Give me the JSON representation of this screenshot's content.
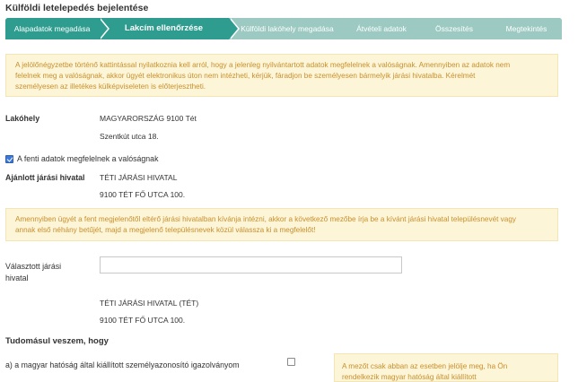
{
  "page": {
    "title": "Külföldi letelepedés bejelentése"
  },
  "steps": [
    {
      "label": "Alapadatok megadása",
      "state": "done"
    },
    {
      "label": "Lakcím ellenőrzése",
      "state": "active"
    },
    {
      "label": "Külföldi lakóhely megadása",
      "state": "todo"
    },
    {
      "label": "Átvételi adatok",
      "state": "todo"
    },
    {
      "label": "Összesítés",
      "state": "todo"
    },
    {
      "label": "Megtekintés",
      "state": "todo"
    }
  ],
  "notice_top": {
    "line1": "A jelölőnégyzetbe történő kattintással nyilatkoznia kell arról, hogy a jelenleg nyilvántartott adatok megfelelnek a valóságnak. Amennyiben az adatok nem",
    "line2": "felelnek meg a valóságnak, akkor ügyét elektronikus úton nem intézheti, kérjük, fáradjon be személyesen bármelyik járási hivatalba. Kérelmét",
    "line3": "személyesen az illetékes külképviseleten is előterjesztheti."
  },
  "residence": {
    "label": "Lakóhely",
    "line1": "MAGYARORSZÁG 9100 Tét",
    "line2": "Szentkút utca 18."
  },
  "confirm": {
    "label": "A fenti adatok megfelelnek a valóságnak",
    "checked": true
  },
  "recommended_office": {
    "label": "Ajánlott járási hivatal",
    "name": "TÉTI JÁRÁSI HIVATAL",
    "address": "9100 TÉT FŐ UTCA 100."
  },
  "notice_office": {
    "line1": "Amennyiben ügyét a fent megjelenőtől eltérő járási hivatalban kívánja intézni, akkor a következő mezőbe írja be a kívánt járási hivatal településnevét vagy",
    "line2": "annak első néhány betűjét, majd a megjelenő településnevek közül válassza ki a megfelelőt!"
  },
  "selected_office": {
    "label_line1": "Választott járási",
    "label_line2": "hivatal",
    "input_value": "",
    "name": "TÉTI JÁRÁSI HIVATAL (TÉT)",
    "address": "9100 TÉT FŐ UTCA 100."
  },
  "acknowledge": {
    "heading": "Tudomásul veszem, hogy",
    "item_a": "a) a magyar hatóság által kiállított személyazonosító igazolványom",
    "item_a_checked": false
  },
  "notice_id": {
    "line1": "A mezőt csak abban az esetben jelölje meg, ha Ön",
    "line2": "rendelkezik magyar hatóság által kiállított"
  },
  "colors": {
    "step_active": "#2e9c8e",
    "step_todo": "#9cc9c2",
    "notice_bg": "#fdf5d8",
    "notice_text": "#c98f2a"
  }
}
